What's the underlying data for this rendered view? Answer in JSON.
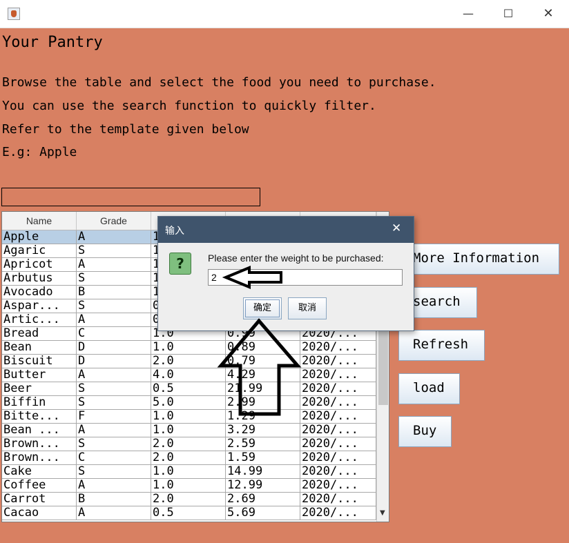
{
  "window": {
    "minimize_glyph": "—",
    "maximize_glyph": "☐",
    "close_glyph": "✕",
    "app_icon": "java-icon"
  },
  "main": {
    "title": "Your Pantry",
    "line1": "Browse the table and select the food you need to purchase.",
    "line2": "You can use the search function to quickly filter.",
    "line3": "Refer to the template given below",
    "line4": "E.g: Apple",
    "search_value": ""
  },
  "table": {
    "columns": [
      "Name",
      "Grade",
      "",
      "",
      ""
    ],
    "rows": [
      [
        "Apple",
        "A",
        "1",
        "",
        ""
      ],
      [
        "Agaric",
        "S",
        "1",
        "",
        ""
      ],
      [
        "Apricot",
        "A",
        "1",
        "",
        ""
      ],
      [
        "Arbutus",
        "S",
        "1",
        "",
        ""
      ],
      [
        "Avocado",
        "B",
        "1",
        "",
        ""
      ],
      [
        "Aspar...",
        "S",
        "0",
        "",
        ""
      ],
      [
        "Artic...",
        "A",
        "0",
        "",
        ""
      ],
      [
        "Bread",
        "C",
        "1.0",
        "0.99",
        "2020/..."
      ],
      [
        "Bean",
        "D",
        "1.0",
        "0.89",
        "2020/..."
      ],
      [
        "Biscuit",
        "D",
        "2.0",
        "0.79",
        "2020/..."
      ],
      [
        "Butter",
        "A",
        "4.0",
        "4.29",
        "2020/..."
      ],
      [
        "Beer",
        "S",
        "0.5",
        "21.99",
        "2020/..."
      ],
      [
        "Biffin",
        "S",
        "5.0",
        "2.99",
        "2020/..."
      ],
      [
        "Bitte...",
        "F",
        "1.0",
        "1.29",
        "2020/..."
      ],
      [
        "Bean ...",
        "A",
        "1.0",
        "3.29",
        "2020/..."
      ],
      [
        "Brown...",
        "S",
        "2.0",
        "2.59",
        "2020/..."
      ],
      [
        "Brown...",
        "C",
        "2.0",
        "1.59",
        "2020/..."
      ],
      [
        "Cake",
        "S",
        "1.0",
        "14.99",
        "2020/..."
      ],
      [
        "Coffee",
        "A",
        "1.0",
        "12.99",
        "2020/..."
      ],
      [
        "Carrot",
        "B",
        "2.0",
        "2.69",
        "2020/..."
      ],
      [
        "Cacao",
        "A",
        "0.5",
        "5.69",
        "2020/..."
      ]
    ],
    "selected_row": 0
  },
  "buttons": {
    "more_information": "More Information",
    "search": "search",
    "refresh": "Refresh",
    "load": "load",
    "buy": "Buy"
  },
  "dialog": {
    "title": "输入",
    "close_glyph": "✕",
    "icon": "question-icon",
    "icon_glyph": "?",
    "message": "Please enter the weight to be purchased:",
    "input_value": "2",
    "ok_label": "确定",
    "cancel_label": "取消"
  },
  "colors": {
    "background": "#d88062",
    "dialog_title": "#3f546c",
    "selected_row": "#b8cfe5"
  }
}
